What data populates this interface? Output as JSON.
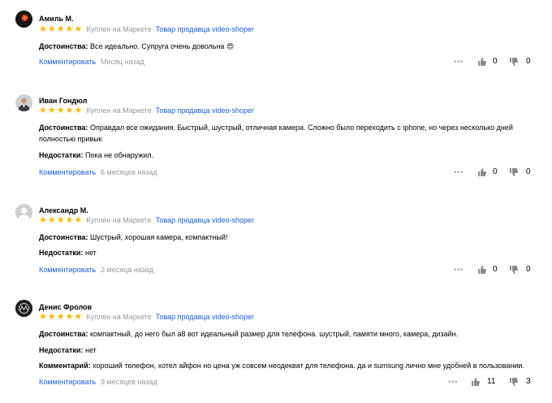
{
  "reviews": [
    {
      "name": "Амиль М.",
      "stars": 5,
      "bought": "Куплен на Маркете",
      "seller": "Товар продавца video-shoper",
      "lines": [
        {
          "label": "Достоинства:",
          "text": "Все идеально. Супруга очень довольна 😍"
        }
      ],
      "comment_label": "Комментировать",
      "time": "Месяц назад",
      "likes": "0",
      "dislikes": "0"
    },
    {
      "name": "Иван Гондюл",
      "stars": 5,
      "bought": "Куплен на Маркете",
      "seller": "Товар продавца video-shoper",
      "lines": [
        {
          "label": "Достоинства:",
          "text": "Оправдал все ожидания. Быстрый, шустрый, отличная камера. Сложно было переходить с iphone, но через несколько дней полностью привык"
        },
        {
          "label": "Недостатки:",
          "text": "Пока не обнаружил."
        }
      ],
      "comment_label": "Комментировать",
      "time": "6 месяцев назад",
      "likes": "0",
      "dislikes": "0"
    },
    {
      "name": "Александр М.",
      "stars": 5,
      "bought": "Куплен на Маркете",
      "seller": "Товар продавца video-shoper",
      "lines": [
        {
          "label": "Достоинства:",
          "text": "Шустрый, хорошая камера, компактный!"
        },
        {
          "label": "Недостатки:",
          "text": "нет"
        }
      ],
      "comment_label": "Комментировать",
      "time": "2 месяца назад",
      "likes": "0",
      "dislikes": "0"
    },
    {
      "name": "Денис Фролов",
      "stars": 5,
      "bought": "Куплен на Маркете",
      "seller": "Товар продавца video-shoper",
      "lines": [
        {
          "label": "Достоинства:",
          "text": "компактный, до него был а8 вот идеальный размер для телефона. шустрый, памяти много, камера, дизайн."
        },
        {
          "label": "Недостатки:",
          "text": "нет"
        },
        {
          "label": "Комментарий:",
          "text": "хороший телефон, хотел айфон но цена уж совсем неодекват для телефона. да и sumsung лично мне удобней в пользовании."
        }
      ],
      "comment_label": "Комментировать",
      "time": "9 месяцев назад",
      "likes": "11",
      "dislikes": "3"
    }
  ],
  "icons": {
    "star": "star-icon",
    "more": "more-dots-icon",
    "like": "thumb-up-icon",
    "dislike": "thumb-down-icon"
  },
  "colors": {
    "star": "#ffb800",
    "link": "#1a5ed6",
    "muted": "#999999"
  }
}
